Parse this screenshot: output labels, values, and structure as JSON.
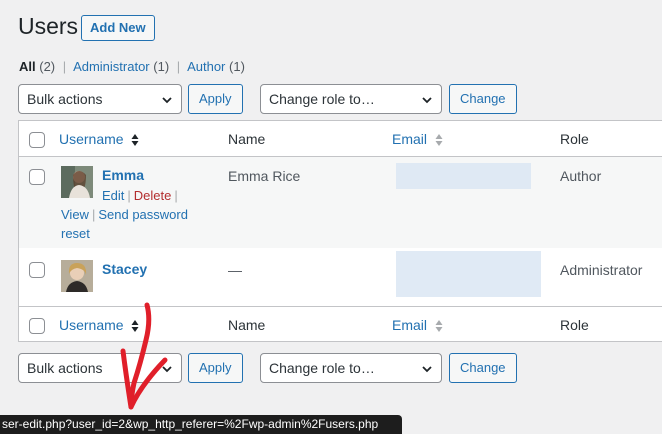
{
  "header": {
    "title": "Users",
    "add_new_label": "Add New"
  },
  "views": {
    "all": {
      "label": "All",
      "count": "(2)"
    },
    "administrator": {
      "label": "Administrator",
      "count": "(1)"
    },
    "author": {
      "label": "Author",
      "count": "(1)"
    },
    "separator": "|"
  },
  "bulk": {
    "selected": "Bulk actions",
    "apply_label": "Apply"
  },
  "role_change": {
    "selected": "Change role to…",
    "change_label": "Change"
  },
  "columns": {
    "username": "Username",
    "name": "Name",
    "email": "Email",
    "role": "Role"
  },
  "users": [
    {
      "username": "Emma",
      "name": "Emma Rice",
      "role": "Author",
      "actions": {
        "edit": "Edit",
        "delete": "Delete",
        "view": "View",
        "send_reset_line1": "Send password",
        "send_reset_line2": "reset"
      }
    },
    {
      "username": "Stacey",
      "name": "—",
      "role": "Administrator"
    }
  ],
  "status_bar": {
    "url": "ser-edit.php?user_id=2&wp_http_referer=%2Fwp-admin%2Fusers.php"
  },
  "colors": {
    "link": "#2271b1",
    "delete": "#b32d2e",
    "annotation_arrow": "#e01f2a",
    "background": "#f0f0f1"
  },
  "icons": {
    "sort": "sort-arrows-icon",
    "dropdown": "chevron-down-icon",
    "annotation": "red-arrow-annotation"
  }
}
